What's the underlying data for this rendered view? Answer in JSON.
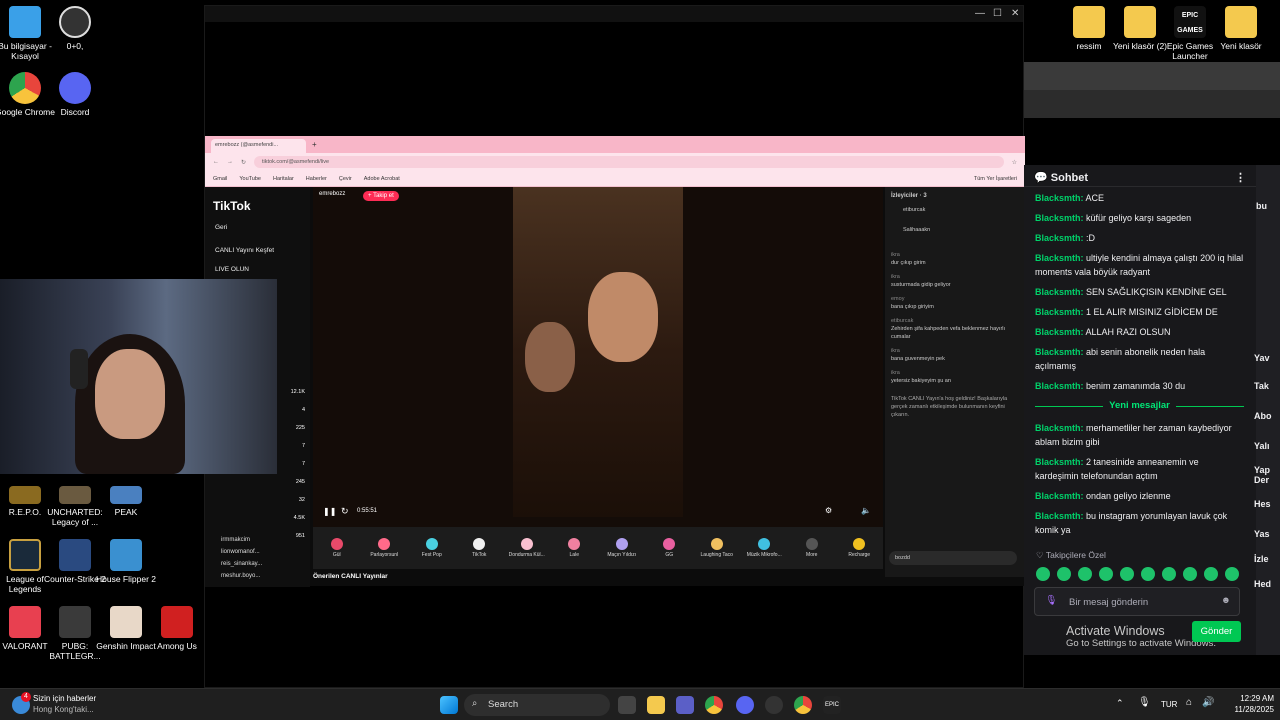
{
  "desktop": {
    "top_left": [
      {
        "label": "Bu bilgisayar - Kısayol",
        "color": "#3aa0e8"
      },
      {
        "label": "0+0,",
        "color": "#555555"
      },
      {
        "label": "Google Chrome",
        "color": "#e8453c"
      },
      {
        "label": "Discord",
        "color": "#5865f2"
      }
    ],
    "top_right": [
      {
        "label": "ressim",
        "color": "#f4c94e"
      },
      {
        "label": "Yeni klasör (2)",
        "color": "#f4c94e"
      },
      {
        "label": "Epic Games Launcher",
        "color": "#111111",
        "text": "EPIC GAMES"
      },
      {
        "label": "Yeni klasör",
        "color": "#f4c94e"
      }
    ],
    "games": [
      {
        "label": "R.E.P.O.",
        "color": "#8a6a20"
      },
      {
        "label": "UNCHARTED: Legacy of ...",
        "color": "#6a5a40"
      },
      {
        "label": "PEAK",
        "color": "#4a80c0"
      },
      {
        "label": "League of Legends",
        "color": "#c8a040"
      },
      {
        "label": "Counter-Strike 2",
        "color": "#2a4a80"
      },
      {
        "label": "House Flipper 2",
        "color": "#3a90d0"
      },
      {
        "label": "VALORANT",
        "color": "#e84050"
      },
      {
        "label": "PUBG: BATTLEGR...",
        "color": "#3a3a3a"
      },
      {
        "label": "Genshin Impact",
        "color": "#e8d8c8"
      },
      {
        "label": "Among Us",
        "color": "#d02020"
      }
    ]
  },
  "window": {
    "controls": [
      "—",
      "☐",
      "✕"
    ]
  },
  "browser": {
    "tab_title": "emrebozz (@asmefendi...",
    "url": "tiktok.com/@asmefendi/live",
    "bookmarks": [
      "Gmail",
      "YouTube",
      "Haritalar",
      "Haberler",
      "Çevir",
      "Adobe Acrobat"
    ],
    "bookmarks_right": "Tüm Yer İşaretleri"
  },
  "tiktok": {
    "logo": "TikTok",
    "nav": [
      "Geri",
      "CANLI Yayını Keşfet",
      "LIVE OLUN"
    ],
    "streamer": "emrebozz",
    "follow": "+ Takip et",
    "time": "0:55:51",
    "viewers_label": "İzleyiciler · 3",
    "top_viewers": [
      "etiburcak",
      "Salihaaakn"
    ],
    "chat": [
      {
        "user": "ikra",
        "text": "dur çıkıp girim"
      },
      {
        "user": "ikra",
        "text": "susturmada gidip geliyor"
      },
      {
        "user": "emoy",
        "text": "bana çıkıp giriyim"
      },
      {
        "user": "etiburcak",
        "text": "Zehirden şifa kahpeden vefa beklenmez hayırlı cumalar"
      },
      {
        "user": "ikra",
        "text": "bana guvenmeyin pek"
      },
      {
        "user": "ikra",
        "text": "yetersiz bakiyeyim şu an"
      }
    ],
    "welcome": "TikTok CANLI Yayın'a hoş geldiniz! Başkalarıyla gerçek zamanlı etkileşimde bulunmanın keyfini çıkarın.",
    "input_value": "bozdd",
    "gifts": [
      "Gül",
      "Parlayorsunl",
      "Fest Pop",
      "TikTok",
      "Dondurma Kül...",
      "Lale",
      "Maçın Yıldızı",
      "GG",
      "Laughing Taco",
      "Müzik Mikrofo...",
      "More",
      "Recharge"
    ],
    "side_stats": [
      "12.1K",
      "4",
      "225",
      "7",
      "7",
      "245",
      "32",
      "4.5K",
      "951"
    ],
    "lower_list": [
      "irmmakcim",
      "lionwomanof...",
      "reis_sinankay...",
      "meshur.boyo..."
    ],
    "recommended": "Önerilen CANLI Yayınlar"
  },
  "twitch_chat": {
    "title": "Sohbet",
    "messages_before": [
      {
        "user": "Blacksmth:",
        "text": "ACE"
      },
      {
        "user": "Blacksmth:",
        "text": "küfür geliyo karşı sageden"
      },
      {
        "user": "Blacksmth:",
        "text": ":D"
      },
      {
        "user": "Blacksmth:",
        "text": "ultiyle kendini almaya çalıştı 200 iq hilal moments vala böyük radyant"
      },
      {
        "user": "Blacksmth:",
        "text": "SEN SAĞLIKÇISIN KENDİNE GEL"
      },
      {
        "user": "Blacksmth:",
        "text": "1 EL ALIR MISINIZ GİDİCEM DE"
      },
      {
        "user": "Blacksmth:",
        "text": "ALLAH RAZI OLSUN"
      },
      {
        "user": "Blacksmth:",
        "text": "abi senin abonelik neden hala açılmamış"
      },
      {
        "user": "Blacksmth:",
        "text": "benim zamanımda 30 du"
      }
    ],
    "new_messages": "Yeni mesajlar",
    "messages_after": [
      {
        "user": "Blacksmth:",
        "text": "merhametliler her zaman kaybediyor ablam bizim gibi"
      },
      {
        "user": "Blacksmth:",
        "text": "2 tanesinide anneanemin ve kardeşimin telefonundan açtım"
      },
      {
        "user": "Blacksmth:",
        "text": "ondan geliyo izlenme"
      },
      {
        "user": "Blacksmth:",
        "text": "bu instagram yorumlayan lavuk çok komik ya"
      }
    ],
    "subs_label": "Takipçilere Özel",
    "input_placeholder": "Bir mesaj gönderin",
    "send": "Gönder",
    "activate_title": "Activate Windows",
    "activate_sub": "Go to Settings to activate Windows.",
    "right_strip": [
      "bu",
      "Yav",
      "Tak",
      "Abo",
      "Yalı",
      "Yap Der",
      "Hes",
      "Yas",
      "İzle",
      "Hed"
    ]
  },
  "taskbar": {
    "news_title": "Sizin için haberler",
    "news_sub": "Hong Kong'taki...",
    "news_badge": "4",
    "search": "Search",
    "lang": "TUR",
    "time": "12:29 AM",
    "date": "11/28/2025"
  }
}
